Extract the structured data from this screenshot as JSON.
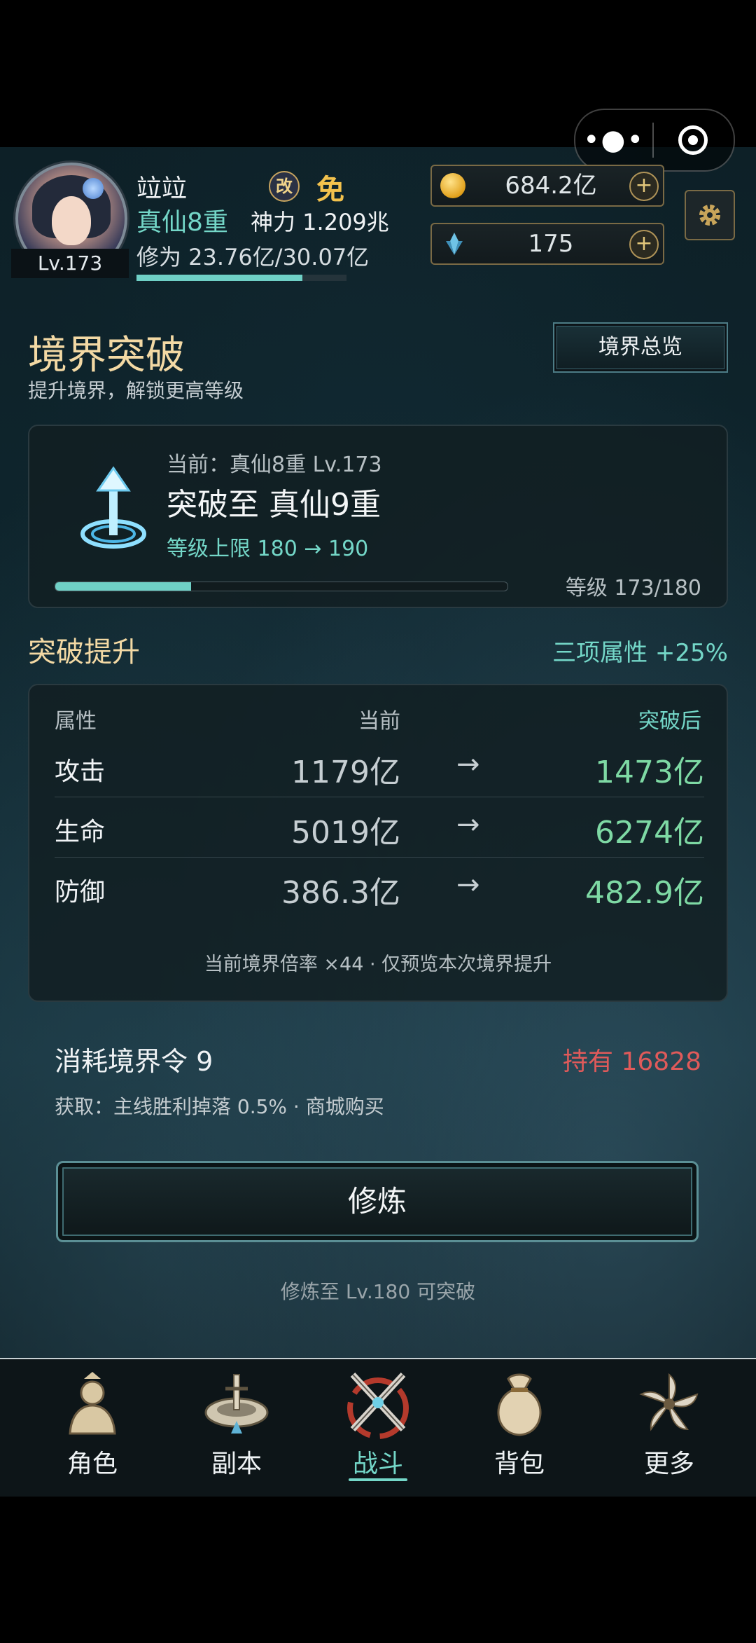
{
  "capsule": {
    "more_icon": "more-dots-icon",
    "close_icon": "target-icon"
  },
  "profile": {
    "level_badge": "Lv.173",
    "name": "竝竝",
    "gai_badge": "改",
    "mian_badge": "免",
    "realm": "真仙8重",
    "power": "神力 1.209兆",
    "cultivation": "修为 23.76亿/30.07亿",
    "cultivation_progress": 0.79
  },
  "resources": [
    {
      "icon": "gold-coin-icon",
      "value": "684.2亿"
    },
    {
      "icon": "crystal-icon",
      "value": "175"
    }
  ],
  "colors": {
    "accent": "#74d7c8",
    "gold": "#f3d9a4",
    "danger": "#e05a5a",
    "green": "#7ed9a4"
  },
  "section": {
    "title": "境界突破",
    "subtitle": "提升境界，解锁更高等级",
    "overview_button": "境界总览"
  },
  "breakthrough": {
    "current": "当前：真仙8重 Lv.173",
    "target": "突破至 真仙9重",
    "cap": "等级上限 180 → 190",
    "level_text": "等级 173/180",
    "level_progress": 0.3
  },
  "boost": {
    "title": "突破提升",
    "summary": "三项属性 +25%",
    "headers": {
      "name": "属性",
      "current": "当前",
      "after": "突破后"
    },
    "rows": [
      {
        "name": "攻击",
        "current": "1179亿",
        "arrow": "→",
        "after": "1473亿"
      },
      {
        "name": "生命",
        "current": "5019亿",
        "arrow": "→",
        "after": "6274亿"
      },
      {
        "name": "防御",
        "current": "386.3亿",
        "arrow": "→",
        "after": "482.9亿"
      }
    ],
    "note": "当前境界倍率 ×44 · 仅预览本次境界提升"
  },
  "cost": {
    "consume": "消耗境界令 9",
    "hold": "持有 16828",
    "obtain": "获取：主线胜利掉落 0.5% · 商城购买"
  },
  "action": {
    "train_button": "修炼",
    "hint": "修炼至 Lv.180 可突破"
  },
  "nav": [
    {
      "label": "角色",
      "icon": "character-icon",
      "active": false
    },
    {
      "label": "副本",
      "icon": "dungeon-icon",
      "active": false
    },
    {
      "label": "战斗",
      "icon": "battle-swords-icon",
      "active": true
    },
    {
      "label": "背包",
      "icon": "bag-icon",
      "active": false
    },
    {
      "label": "更多",
      "icon": "more-icon",
      "active": false
    }
  ]
}
